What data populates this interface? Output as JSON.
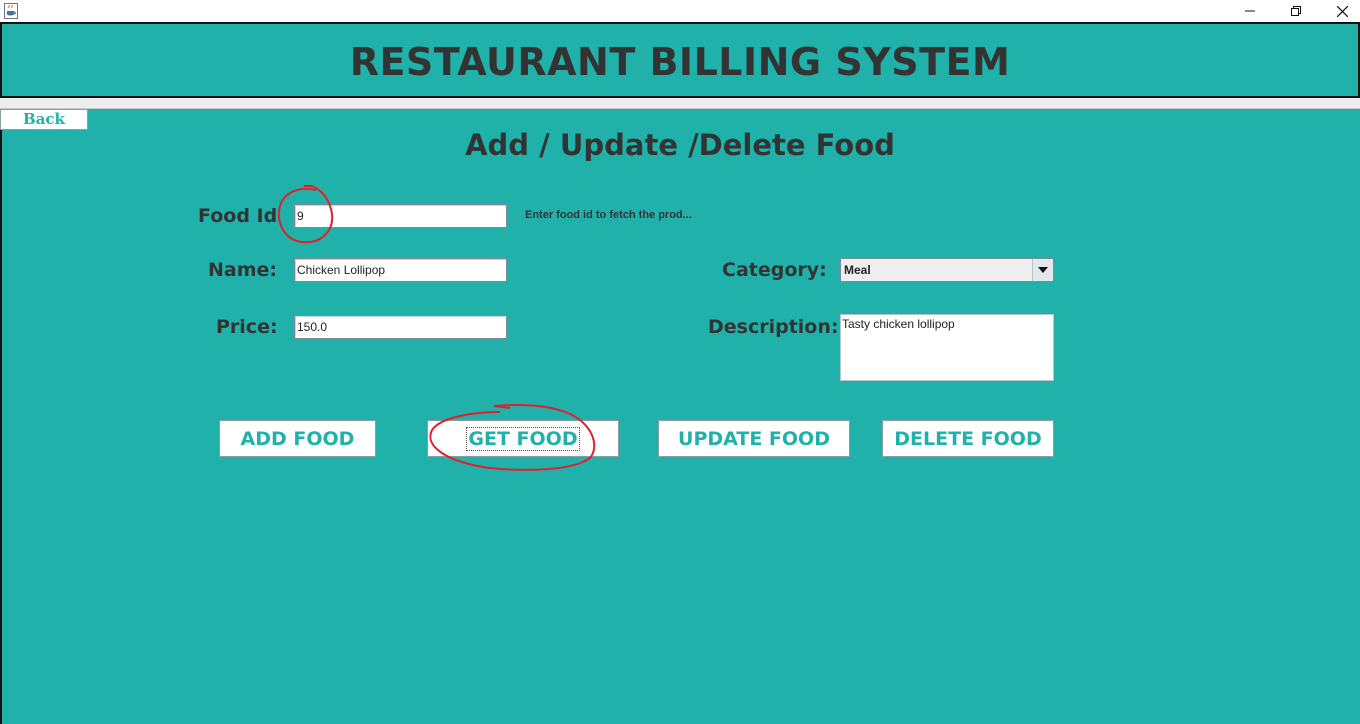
{
  "window": {
    "icon": "java-cup-icon",
    "controls": {
      "minimize": "minimize-icon",
      "restore": "restore-icon",
      "close": "close-icon"
    }
  },
  "header": {
    "title": "RESTAURANT BILLING SYSTEM"
  },
  "nav": {
    "back_label": "Back"
  },
  "page": {
    "title": "Add / Update /Delete Food"
  },
  "form": {
    "food_id": {
      "label": "Food Id",
      "value": "9",
      "hint": "Enter food id to fetch the prod..."
    },
    "name": {
      "label": "Name:",
      "value": "Chicken Lollipop"
    },
    "price": {
      "label": "Price:",
      "value": "150.0"
    },
    "category": {
      "label": "Category:",
      "selected": "Meal"
    },
    "description": {
      "label": "Description:",
      "value": "Tasty chicken lollipop"
    }
  },
  "actions": {
    "add_label": "ADD FOOD",
    "get_label": "GET FOOD",
    "update_label": "UPDATE FOOD",
    "delete_label": "DELETE FOOD"
  },
  "colors": {
    "panel_bg": "#20b2aa",
    "title_text": "#333333",
    "button_text": "#20b2aa",
    "annotation_red": "#e0202a"
  },
  "annotations": [
    "red-circle-food-id",
    "red-circle-get-food-button"
  ]
}
